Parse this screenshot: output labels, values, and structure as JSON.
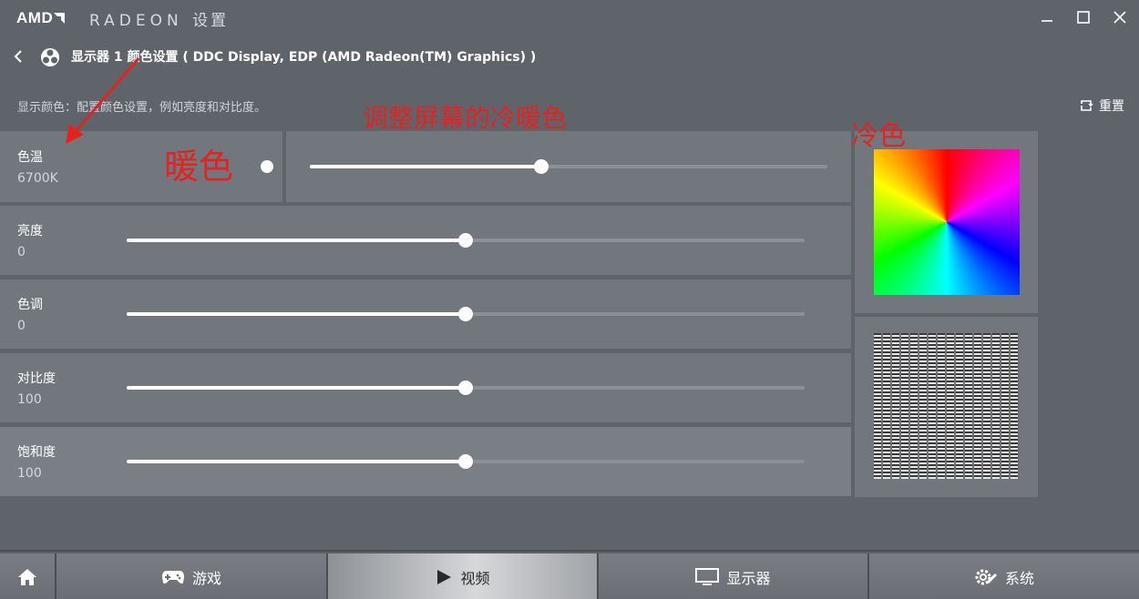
{
  "window": {
    "logo_text": "AMD",
    "brand": "RADEON",
    "title_suffix": "设置"
  },
  "header": {
    "title": "显示器 1 颜色设置 ( DDC Display, EDP (AMD Radeon(TM) Graphics) )"
  },
  "subtitle": "显示颜色：配置颜色设置，例如亮度和对比度。",
  "reset_label": "重置",
  "rows": [
    {
      "label": "色温",
      "value": "6700K",
      "level": 0.447
    },
    {
      "label": "亮度",
      "value": "0",
      "level": 0.5
    },
    {
      "label": "色调",
      "value": "0",
      "level": 0.5
    },
    {
      "label": "对比度",
      "value": "100",
      "level": 0.5
    },
    {
      "label": "饱和度",
      "value": "100",
      "level": 0.5
    }
  ],
  "annotations": {
    "warm": "暖色",
    "cold": "冷色",
    "adjust": "调整屏幕的冷暖色"
  },
  "nav": [
    {
      "label": "",
      "icon": "home-icon"
    },
    {
      "label": "游戏",
      "icon": "gamepad-icon"
    },
    {
      "label": "视频",
      "icon": "play-icon"
    },
    {
      "label": "显示器",
      "icon": "monitor-icon"
    },
    {
      "label": "系统",
      "icon": "gear-wrench-icon"
    }
  ],
  "colors": {
    "background": "#5f646b",
    "panel": "#72777e",
    "annotation": "#e42222",
    "active_tab": "#d7d8da"
  }
}
